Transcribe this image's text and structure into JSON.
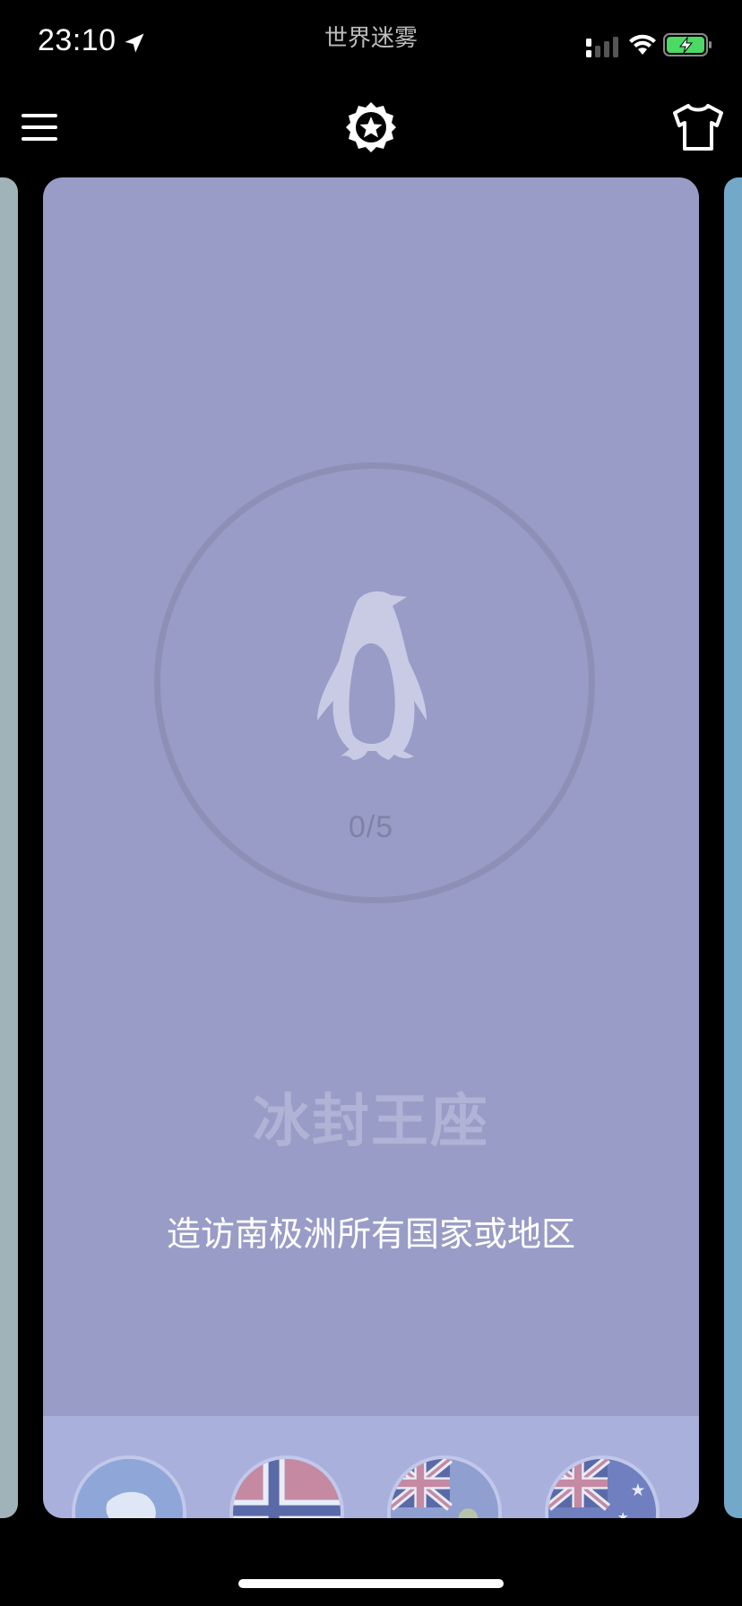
{
  "status_bar": {
    "time": "23:10",
    "app_name": "世界迷雾"
  },
  "toolbar": {
    "menu_icon": "hamburger-menu-icon",
    "center_icon": "star-badge-icon",
    "right_icon": "t-shirt-icon"
  },
  "achievement": {
    "icon": "penguin-icon",
    "progress": "0/5",
    "title": "冰封王座",
    "description": "造访南极洲所有国家或地区"
  },
  "flags": [
    {
      "name": "antarctica-flag-icon"
    },
    {
      "name": "norway-flag-icon"
    },
    {
      "name": "british-antarctic-territory-flag-icon"
    },
    {
      "name": "australia-flag-icon"
    }
  ],
  "colors": {
    "card_background": "#999cc6",
    "title_color": "#b0b3d6",
    "ring_color": "#8d8fb6",
    "left_peek_card": "#9fb3b8",
    "right_peek_card": "#74a8c8"
  }
}
